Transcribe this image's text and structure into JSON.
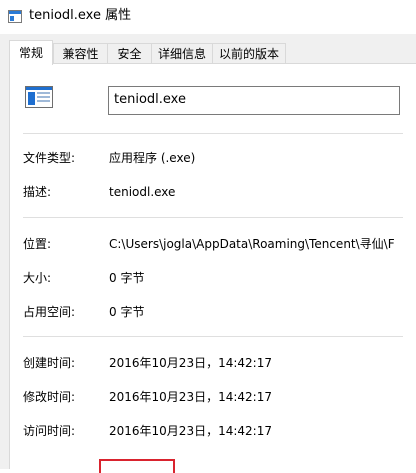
{
  "window": {
    "title": "teniodl.exe 属性",
    "title_icon": "generic-window-icon"
  },
  "tabs": [
    {
      "label": "常规",
      "active": true
    },
    {
      "label": "兼容性",
      "active": false
    },
    {
      "label": "安全",
      "active": false
    },
    {
      "label": "详细信息",
      "active": false
    },
    {
      "label": "以前的版本",
      "active": false
    }
  ],
  "general": {
    "file_icon": "application-icon",
    "file_name": "teniodl.exe",
    "rows": {
      "type": {
        "label": "文件类型:",
        "value": "应用程序 (.exe)"
      },
      "description": {
        "label": "描述:",
        "value": "teniodl.exe"
      },
      "location": {
        "label": "位置:",
        "value": "C:\\Users\\jogla\\AppData\\Roaming\\Tencent\\寻仙\\F"
      },
      "size": {
        "label": "大小:",
        "value": "0 字节"
      },
      "size_on_disk": {
        "label": "占用空间:",
        "value": "0 字节"
      },
      "created": {
        "label": "创建时间:",
        "value": "2016年10月23日，14:42:17"
      },
      "modified": {
        "label": "修改时间:",
        "value": "2016年10月23日，14:42:17"
      },
      "accessed": {
        "label": "访问时间:",
        "value": "2016年10月23日，14:42:17"
      }
    }
  },
  "colors": {
    "accent_blue": "#1f6fd0",
    "highlight_red": "#d9232e"
  }
}
